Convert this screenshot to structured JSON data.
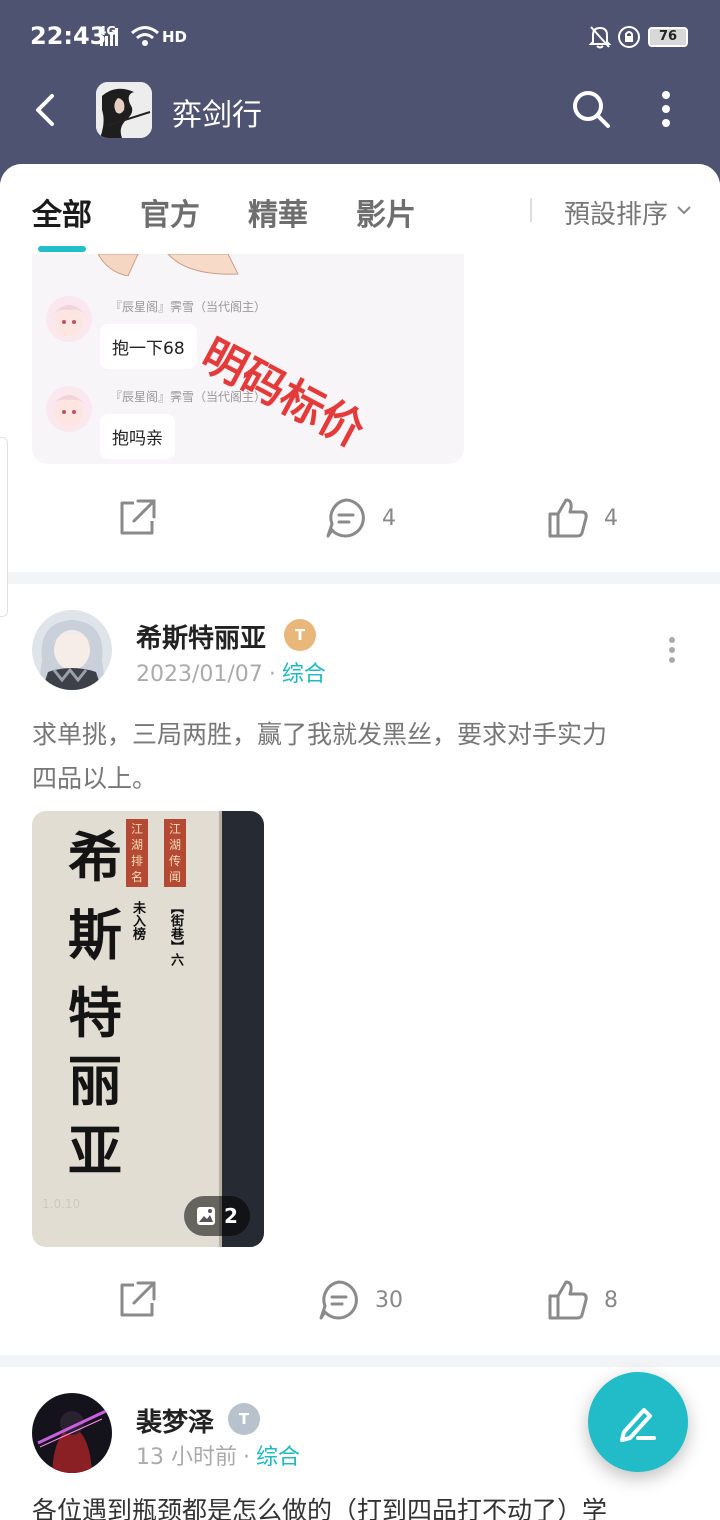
{
  "status_bar": {
    "time": "22:43",
    "network": "4G",
    "hd": "HD",
    "battery": "76"
  },
  "app_bar": {
    "title": "弈剑行"
  },
  "tabs": {
    "items": [
      "全部",
      "官方",
      "精華",
      "影片"
    ],
    "active_index": 0,
    "sort_label": "預設排序"
  },
  "post1": {
    "image_chat": [
      {
        "name": "『辰星阁』霁雪（当代阁主）",
        "message": "抱一下68"
      },
      {
        "name": "『辰星阁』霁雪（当代阁主）",
        "message": "抱吗亲"
      }
    ],
    "stamp_text": "明码标价",
    "comments": "4",
    "likes": "4"
  },
  "post2": {
    "username": "希斯特丽亚",
    "level_badge": "T",
    "date": "2023/01/07",
    "separator": "·",
    "category": "综合",
    "text_line1": "求单挑，三局两胜，赢了我就发黑丝，要求对手实力",
    "text_line2": "四品以上。",
    "poster": {
      "name_chars": [
        "希",
        "斯",
        "特",
        "丽",
        "亚"
      ],
      "tag1": "江湖排名",
      "tag1_value": "未入榜",
      "tag2": "江湖传闻",
      "tag2_value": "【街巷】六",
      "version": "1.0.10"
    },
    "image_count": "2",
    "comments": "30",
    "likes": "8"
  },
  "post3": {
    "username": "裴梦泽",
    "level_badge": "T",
    "time": "13 小时前",
    "separator": "·",
    "category": "综合",
    "text_line1": "各位遇到瓶颈都是怎么做的（打到四品打不动了）学"
  },
  "colors": {
    "header_bg": "#4f5372",
    "accent": "#21bfc9",
    "stamp_red": "#e53a3a",
    "gold_badge": "#e9b77a",
    "silver_badge": "#b8c2cc"
  }
}
